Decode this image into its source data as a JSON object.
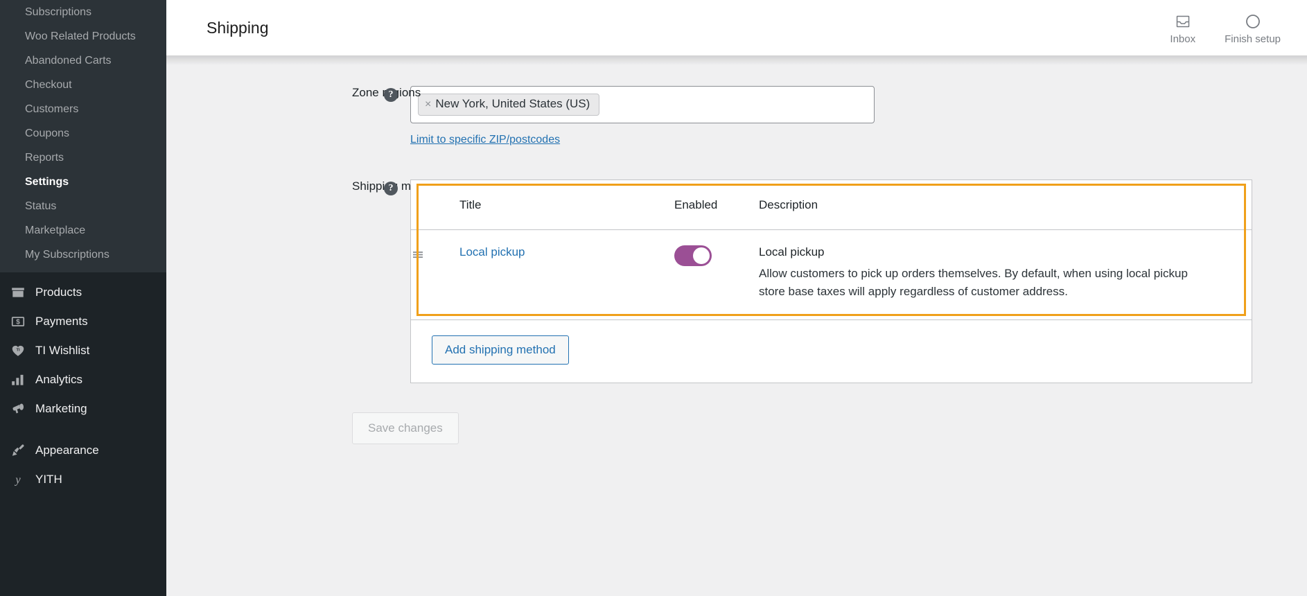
{
  "sidebar": {
    "submenu": [
      {
        "label": "Subscriptions",
        "current": false
      },
      {
        "label": "Woo Related Products",
        "current": false
      },
      {
        "label": "Abandoned Carts",
        "current": false
      },
      {
        "label": "Checkout",
        "current": false
      },
      {
        "label": "Customers",
        "current": false
      },
      {
        "label": "Coupons",
        "current": false
      },
      {
        "label": "Reports",
        "current": false
      },
      {
        "label": "Settings",
        "current": true
      },
      {
        "label": "Status",
        "current": false
      },
      {
        "label": "Marketplace",
        "current": false
      },
      {
        "label": "My Subscriptions",
        "current": false
      }
    ],
    "menu_group_1": [
      {
        "label": "Products",
        "icon": "products-box-icon"
      },
      {
        "label": "Payments",
        "icon": "payments-dollar-icon"
      },
      {
        "label": "TI Wishlist",
        "icon": "heart-icon"
      },
      {
        "label": "Analytics",
        "icon": "bar-chart-icon"
      },
      {
        "label": "Marketing",
        "icon": "megaphone-icon"
      }
    ],
    "menu_group_2": [
      {
        "label": "Appearance",
        "icon": "paintbrush-icon"
      },
      {
        "label": "YITH",
        "icon": "yith-logo-icon"
      }
    ]
  },
  "header": {
    "title": "Shipping",
    "actions": [
      {
        "label": "Inbox",
        "icon": "inbox-tray-icon"
      },
      {
        "label": "Finish setup",
        "icon": "progress-circle-icon"
      }
    ]
  },
  "zone_regions": {
    "label": "Zone regions",
    "help": "?",
    "tokens": [
      {
        "remove": "×",
        "label": "New York, United States (US)"
      }
    ],
    "zip_link": "Limit to specific ZIP/postcodes"
  },
  "shipping_methods": {
    "label": "Shipping methods",
    "help": "?",
    "columns": {
      "handle": "",
      "title": "Title",
      "enabled": "Enabled",
      "description": "Description"
    },
    "rows": [
      {
        "handle_icon": "drag-handle-icon",
        "title": "Local pickup",
        "enabled": true,
        "desc_title": "Local pickup",
        "desc_body": "Allow customers to pick up orders themselves. By default, when using local pickup store base taxes will apply regardless of customer address."
      }
    ],
    "add_button": "Add shipping method"
  },
  "footer": {
    "save_button": "Save changes",
    "save_disabled": true
  },
  "colors": {
    "sidebar_bg": "#1d2327",
    "submenu_bg": "#2c3338",
    "accent_link": "#2271b1",
    "toggle_on": "#9b4f95",
    "focus_ring": "#f0a01a",
    "page_bg": "#f0f0f1"
  }
}
